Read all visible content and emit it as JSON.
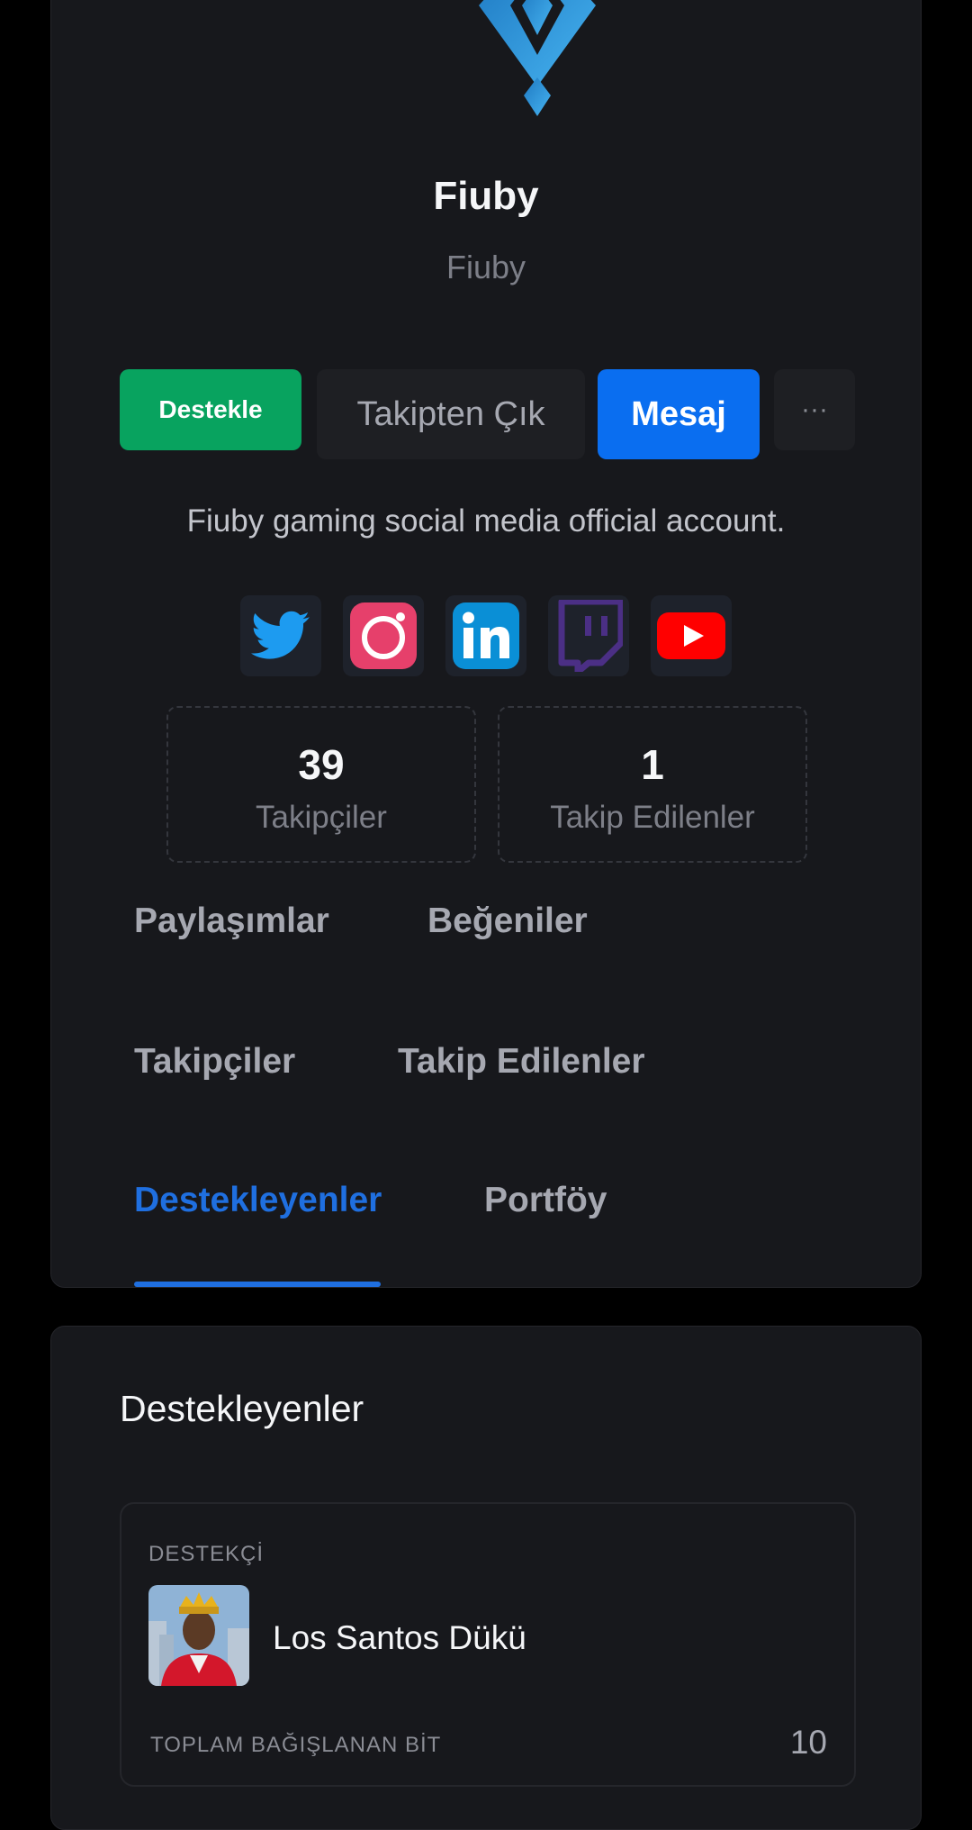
{
  "profile": {
    "name": "Fiuby",
    "handle": "Fiuby",
    "bio": "Fiuby gaming social media official account.",
    "logo_icon": "fiuby-diamond-logo"
  },
  "actions": {
    "support_label": "Destekle",
    "unfollow_label": "Takipten Çık",
    "message_label": "Mesaj",
    "more_label": "···"
  },
  "socials": [
    {
      "name": "twitter-icon",
      "color": "#1d9bf0"
    },
    {
      "name": "instagram-icon",
      "color": "#e6406b"
    },
    {
      "name": "linkedin-icon",
      "color": "#0a8fd6"
    },
    {
      "name": "twitch-icon",
      "color": "#4b2f85"
    },
    {
      "name": "youtube-icon",
      "color": "#ff0000"
    }
  ],
  "stats": {
    "followers_count": "39",
    "followers_label": "Takipçiler",
    "following_count": "1",
    "following_label": "Takip Edilenler"
  },
  "tabs": [
    {
      "label": "Paylaşımlar",
      "active": false
    },
    {
      "label": "Beğeniler",
      "active": false
    },
    {
      "label": "Takipçiler",
      "active": false
    },
    {
      "label": "Takip Edilenler",
      "active": false
    },
    {
      "label": "Destekleyenler",
      "active": true
    },
    {
      "label": "Portföy",
      "active": false
    }
  ],
  "supporters_section": {
    "title": "Destekleyenler",
    "supporter_label": "DESTEKÇİ",
    "supporter_name": "Los Santos Dükü",
    "total_label": "TOPLAM BAĞIŞLANAN BİT",
    "total_value": "10"
  },
  "colors": {
    "accent": "#1f6fe0",
    "support_green": "#08a35f",
    "message_blue": "#0a6ef0",
    "card_bg": "#17181c"
  }
}
